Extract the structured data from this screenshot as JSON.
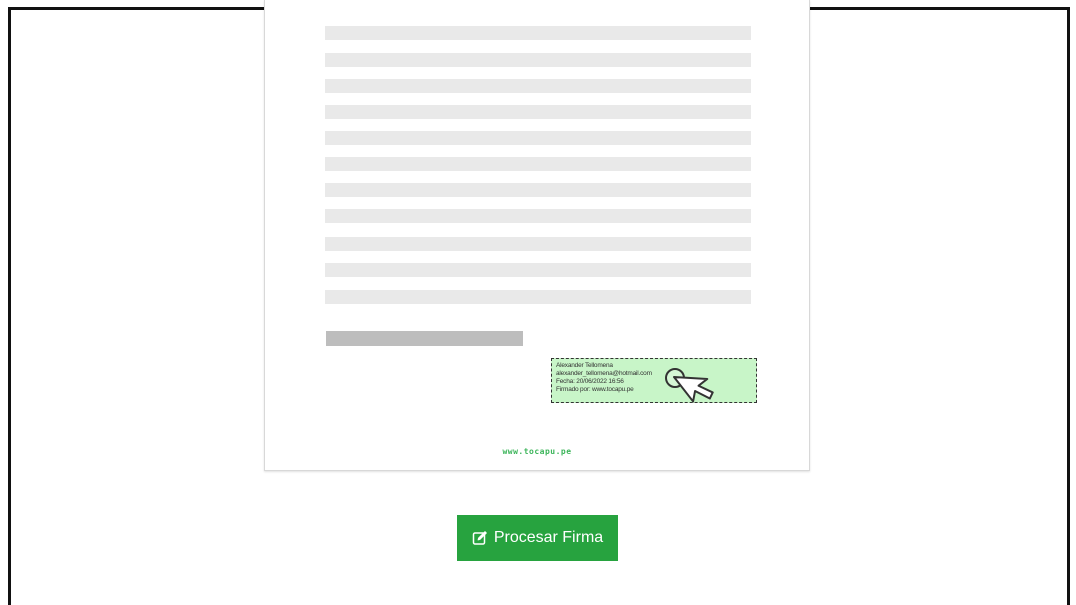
{
  "document": {
    "signature_block": {
      "lines": [
        "Alexander Tellomena",
        "alexander_tellomena@hotmail.com",
        "Fecha: 20/06/2022 16:56",
        "Firmado por: www.tocapu.pe"
      ]
    },
    "watermark": "www.tocapu.pe",
    "placeholder_line_count": 11
  },
  "actions": {
    "process_button_label": "Procesar Firma",
    "process_button_icon": "edit-icon"
  },
  "colors": {
    "signature_highlight": "#c8f5c8",
    "button_green": "#27a33f",
    "watermark_green": "#3cb55a",
    "placeholder_line": "#e9e9e9",
    "signature_line": "#bdbdbd"
  }
}
